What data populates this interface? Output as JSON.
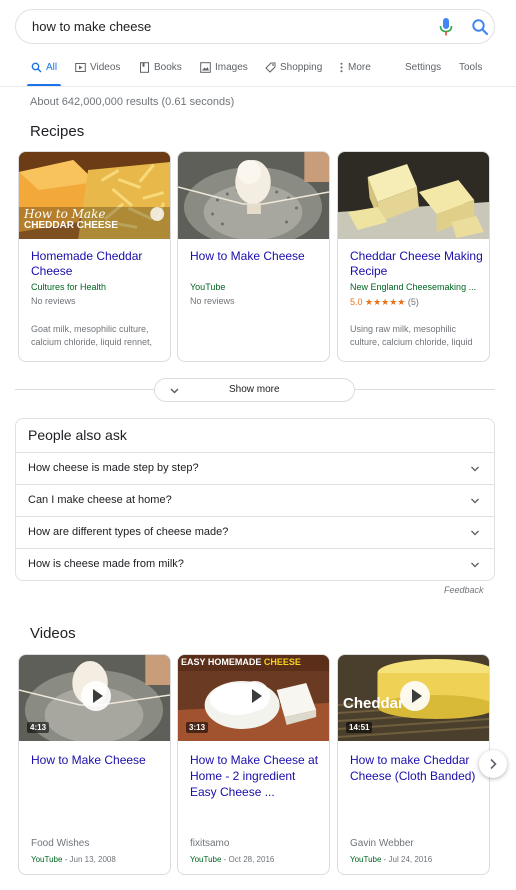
{
  "search": {
    "query": "how to make cheese"
  },
  "tabs": [
    {
      "label": "All",
      "active": true
    },
    {
      "label": "Videos"
    },
    {
      "label": "Books"
    },
    {
      "label": "Images"
    },
    {
      "label": "Shopping"
    },
    {
      "label": "More"
    }
  ],
  "tools": {
    "settings": "Settings",
    "tools": "Tools"
  },
  "results_count": "About 642,000,000 results (0.61 seconds)",
  "recipes": {
    "title": "Recipes",
    "cards": [
      {
        "image_text_1": "How to Make",
        "image_text_2": "CHEDDAR CHEESE",
        "title": "Homemade Cheddar Cheese",
        "source": "Cultures for Health",
        "reviews": "No reviews",
        "ingredients": "Goat milk, mesophilic culture, calcium chloride, liquid rennet,"
      },
      {
        "title": "How to Make Cheese",
        "source": "YouTube",
        "reviews": "No reviews"
      },
      {
        "title": "Cheddar Cheese Making Recipe",
        "source": "New England Cheesemaking ...",
        "rating_value": "5.0",
        "rating_stars": "★★★★★",
        "rating_count": "(5)",
        "rating_fraction": 1.0,
        "ingredients": "Using raw milk, mesophilic culture, calcium chloride, liquid"
      }
    ],
    "show_more": "Show more"
  },
  "people_also_ask": {
    "title": "People also ask",
    "questions": [
      "How cheese is made step by step?",
      "Can I make cheese at home?",
      "How are different types of cheese made?",
      "How is cheese made from milk?"
    ],
    "feedback": "Feedback"
  },
  "videos": {
    "title": "Videos",
    "cards": [
      {
        "duration": "4:13",
        "title": "How to Make Cheese",
        "author": "Food Wishes",
        "site": "YouTube",
        "date": " - Jun 13, 2008"
      },
      {
        "duration": "3:13",
        "banner_1": "EASY HOMEMADE ",
        "banner_2": "CHEESE",
        "title": "How to Make Cheese at Home - 2 ingredient Easy Cheese ...",
        "author": "fixitsamo",
        "site": "YouTube",
        "date": " - Oct 28, 2016"
      },
      {
        "duration": "14:51",
        "overlay": "Cheddar",
        "title": "How to make Cheddar Cheese (Cloth Banded)",
        "author": "Gavin Webber",
        "site": "YouTube",
        "date": " - Jul 24, 2016"
      }
    ]
  },
  "colors": {
    "link": "#1a0dab",
    "accent": "#1a73e8",
    "green": "#006621",
    "star": "#e7711b"
  }
}
